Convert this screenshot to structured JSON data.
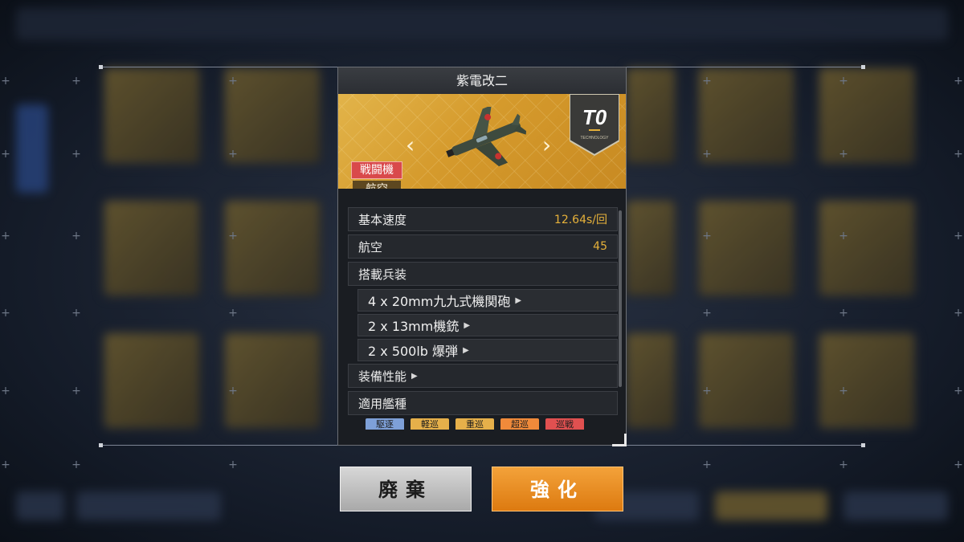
{
  "dialog": {
    "title": "紫電改二",
    "type_tag": "戦闘機",
    "category_tag": "航空",
    "rarity_stars": "★★★★★",
    "tier_badge": "T0",
    "tier_badge_sub": "TECHNOLOGY",
    "stats": [
      {
        "label": "基本速度",
        "value": "12.64s/回"
      },
      {
        "label": "航空",
        "value": "45"
      }
    ],
    "armament_header": "搭載兵装",
    "armament": [
      "4 x 20mm九九式機関砲",
      "2 x 13mm機銃",
      "2 x 500lb 爆弾"
    ],
    "equip_performance": "装備性能",
    "applicable_ships": "適用艦種",
    "ship_types": [
      {
        "label": "駆逐",
        "color": "#7ea0d8"
      },
      {
        "label": "軽巡",
        "color": "#e6b04a"
      },
      {
        "label": "重巡",
        "color": "#e6b04a"
      },
      {
        "label": "超巡",
        "color": "#f08a3a"
      },
      {
        "label": "巡戦",
        "color": "#e05050"
      }
    ]
  },
  "buttons": {
    "discard": "廃棄",
    "enhance": "強化"
  },
  "colors": {
    "accent_gold": "#e6b13a",
    "type_red": "#d9494b",
    "enhance_orange": "#e98a1f"
  }
}
